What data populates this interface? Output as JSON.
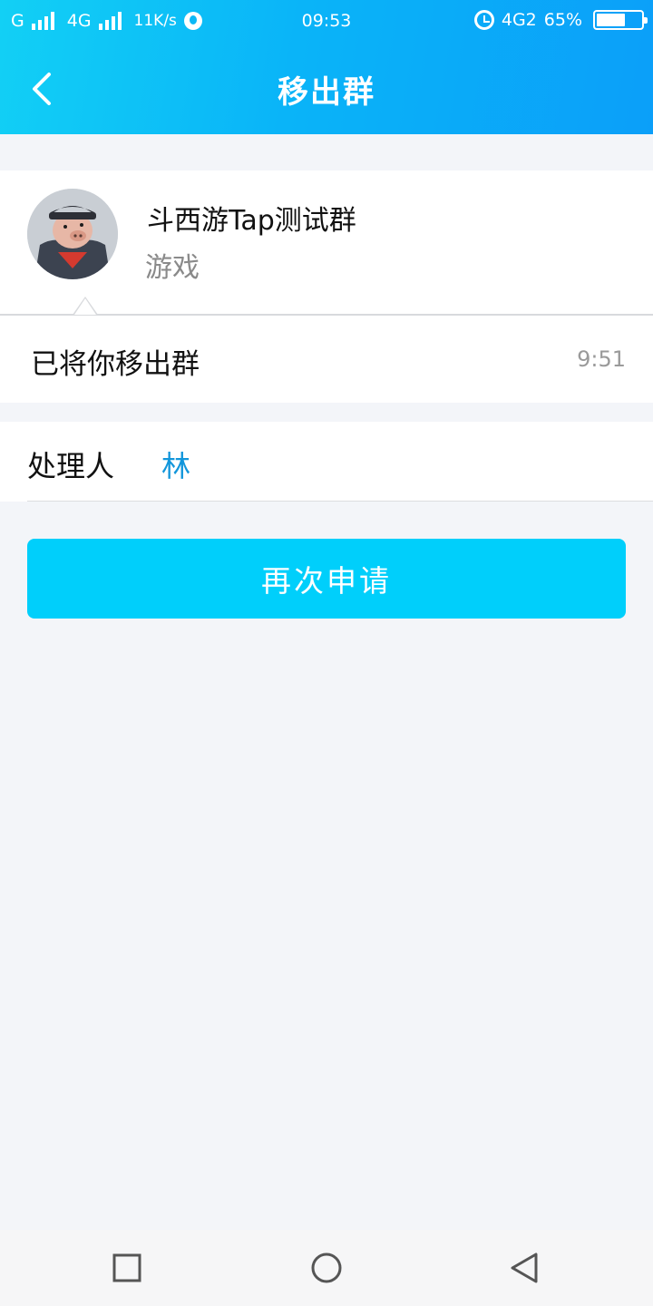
{
  "status_bar": {
    "carrier1": "G",
    "carrier2": "4G",
    "speed": "11K/s",
    "time": "09:53",
    "network": "4G2",
    "battery_text": "65%",
    "battery_level": 0.65
  },
  "header": {
    "title": "移出群",
    "back_icon": "chevron-left-icon"
  },
  "group": {
    "name": "斗西游Tap测试群",
    "category": "游戏",
    "avatar_icon": "pig-avatar"
  },
  "notice": {
    "message": "已将你移出群",
    "time": "9:51"
  },
  "handler": {
    "label": "处理人",
    "name": "林"
  },
  "actions": {
    "reapply_label": "再次申请"
  },
  "colors": {
    "header_gradient_start": "#12d0f5",
    "header_gradient_end": "#0b9ff9",
    "button": "#00cffb",
    "link": "#1296db",
    "background": "#f3f5f9"
  },
  "system_nav": {
    "recent_icon": "square-icon",
    "home_icon": "circle-icon",
    "back_icon": "triangle-back-icon"
  }
}
